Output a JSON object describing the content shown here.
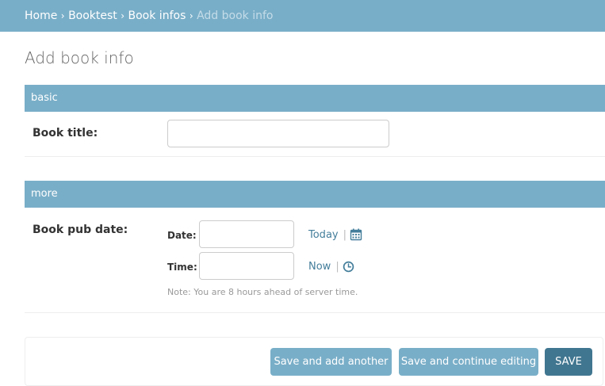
{
  "breadcrumbs": {
    "items": [
      "Home",
      "Booktest",
      "Book infos"
    ],
    "current": "Add book info",
    "separator": "›"
  },
  "page": {
    "title": "Add book info"
  },
  "fieldsets": [
    {
      "name": "basic",
      "fields": [
        {
          "label": "Book title:",
          "value": "",
          "placeholder": ""
        }
      ]
    },
    {
      "name": "more",
      "fields": [
        {
          "label": "Book pub date:",
          "date": {
            "label": "Date:",
            "value": "",
            "shortcut": "Today",
            "icon": "calendar-icon"
          },
          "time": {
            "label": "Time:",
            "value": "",
            "shortcut": "Now",
            "icon": "clock-icon"
          },
          "note": "Note: You are 8 hours ahead of server time."
        }
      ]
    }
  ],
  "submit_row": {
    "save_add_another": "Save and add another",
    "save_continue": "Save and continue editing",
    "save": "SAVE"
  },
  "colors": {
    "header": "#79aec8",
    "link": "#447e9b",
    "primary_button": "#417690"
  }
}
